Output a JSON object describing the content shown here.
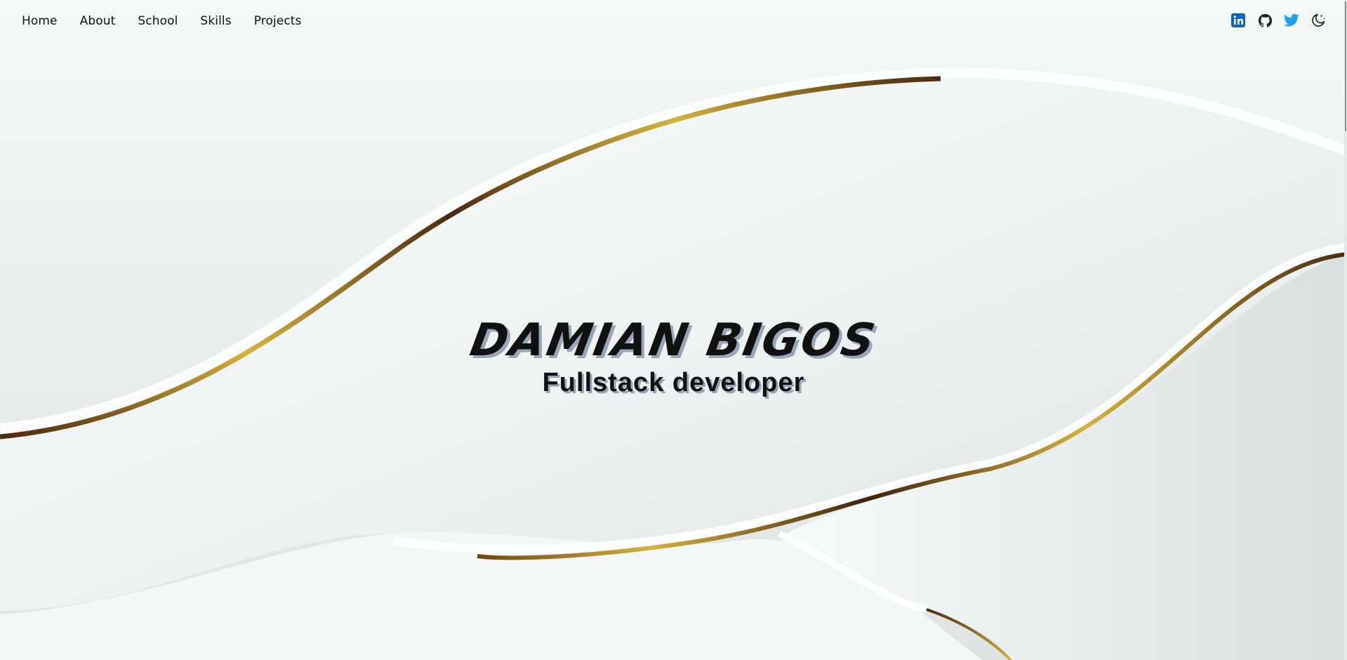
{
  "nav": {
    "links": [
      {
        "label": "Home"
      },
      {
        "label": "About"
      },
      {
        "label": "School"
      },
      {
        "label": "Skills"
      },
      {
        "label": "Projects"
      }
    ],
    "icons": [
      "linkedin-icon",
      "github-icon",
      "twitter-icon",
      "moon-icon"
    ]
  },
  "hero": {
    "name": "DAMIAN BIGOS",
    "role": "Fullstack developer"
  },
  "colors": {
    "linkedin": "#0a66c2",
    "twitter": "#1da1f2",
    "gold": "#d4b33a",
    "dark_brown": "#4a2a10",
    "background": "#eef2f2"
  }
}
